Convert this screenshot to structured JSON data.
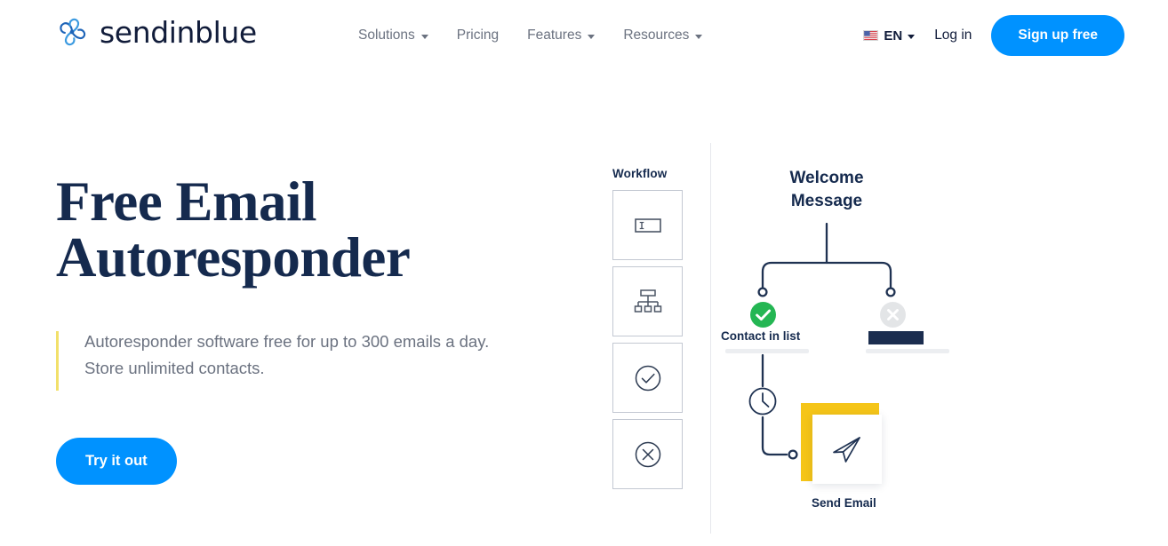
{
  "header": {
    "logo": {
      "icon": "sendinblue-pinwheel-logo-icon",
      "name": "sendinblue"
    },
    "nav": [
      {
        "label": "Solutions",
        "has_dropdown": true
      },
      {
        "label": "Pricing",
        "has_dropdown": false
      },
      {
        "label": "Features",
        "has_dropdown": true
      },
      {
        "label": "Resources",
        "has_dropdown": true
      }
    ],
    "language": {
      "flag": "us-flag-icon",
      "code": "EN",
      "has_dropdown": true
    },
    "login_label": "Log in",
    "signup_label": "Sign up free"
  },
  "hero": {
    "title": "Free Email\nAutoresponder",
    "subtitle": "Autoresponder software free for up to 300 emails a day.\nStore unlimited contacts.",
    "cta_label": "Try it out"
  },
  "workflow_panel": {
    "title": "Workflow",
    "cards": [
      {
        "icon": "text-field-icon"
      },
      {
        "icon": "org-chart-icon"
      },
      {
        "icon": "check-circle-outline-icon"
      },
      {
        "icon": "x-circle-outline-icon"
      }
    ]
  },
  "canvas": {
    "title": "Welcome\nMessage",
    "nodes": [
      {
        "icon": "green-check-circle-icon",
        "label": "Contact in list"
      },
      {
        "icon": "gray-x-circle-icon",
        "label": ""
      },
      {
        "icon": "clock-icon",
        "label": ""
      },
      {
        "icon": "paper-plane-send-icon",
        "label": "Send Email"
      }
    ]
  },
  "colors": {
    "brand_blue": "#0092ff",
    "navy": "#152a4e",
    "accent_yellow": "#f5c518",
    "subtitle_accent": "#f2e06a",
    "success_green": "#22c55e",
    "muted_gray": "#6b7280"
  }
}
